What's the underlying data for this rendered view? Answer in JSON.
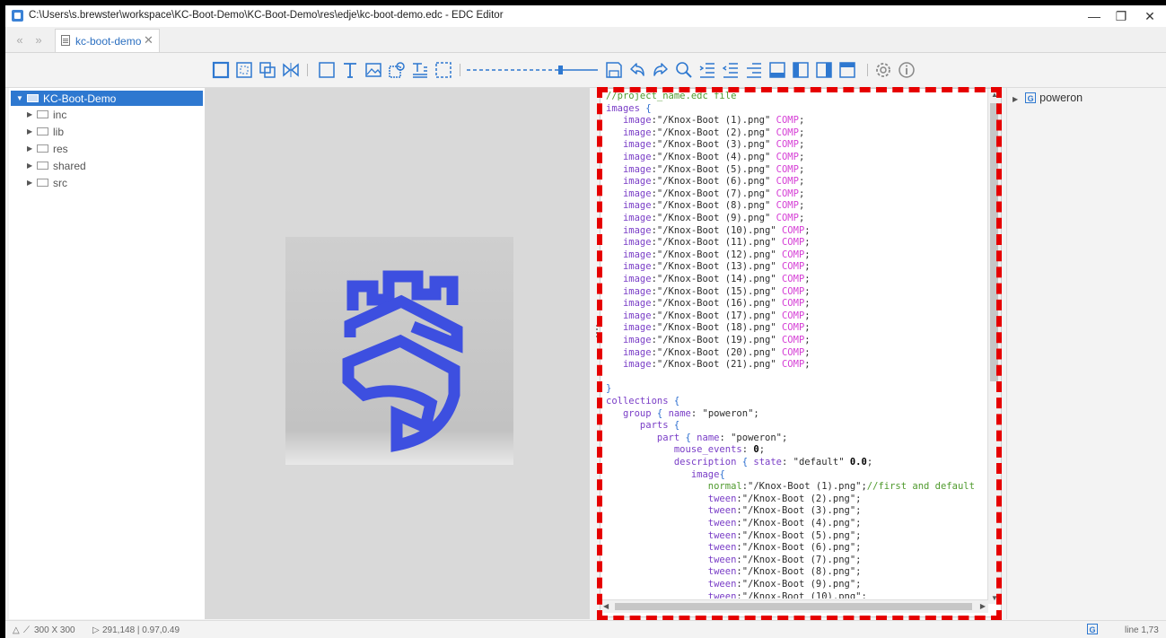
{
  "window": {
    "title": "C:\\Users\\s.brewster\\workspace\\KC-Boot-Demo\\KC-Boot-Demo\\res\\edje\\kc-boot-demo.edc - EDC Editor",
    "controls": {
      "minimize": "—",
      "restore": "❐",
      "close": "✕"
    }
  },
  "tabs": {
    "back": "«",
    "forward": "»",
    "active": {
      "label": "kc-boot-demo",
      "close": "✕"
    }
  },
  "toolbar": {
    "icons": [
      "rect-tool-icon",
      "select-tool-icon",
      "group-tool-icon",
      "mirror-tool-icon",
      "rectangle-icon",
      "text-tool-icon",
      "image-tool-icon",
      "image-settings-icon",
      "textblock-icon",
      "spacer-icon",
      "zoom-slider",
      "save-icon",
      "undo-icon",
      "redo-icon",
      "find-icon",
      "indent-icon",
      "outdent-icon",
      "format-icon",
      "bottom-panel-icon",
      "left-panel-icon",
      "right-panel-icon",
      "top-panel-icon",
      "settings-gear-icon",
      "info-icon"
    ]
  },
  "explorer": {
    "root": "KC-Boot-Demo",
    "folders": [
      "inc",
      "lib",
      "res",
      "shared",
      "src"
    ]
  },
  "editor": {
    "lines": [
      [
        {
          "t": "//project_name.edc file",
          "c": "cm"
        }
      ],
      [
        {
          "t": "images ",
          "c": "kw"
        },
        {
          "t": "{",
          "c": "br"
        }
      ],
      [
        {
          "t": "   image",
          "c": "kw"
        },
        {
          "t": ":\"/Knox-Boot (1).png\" ",
          "c": "str"
        },
        {
          "t": "COMP",
          "c": "cons"
        },
        {
          "t": ";",
          "c": "str"
        }
      ],
      [
        {
          "t": "   image",
          "c": "kw"
        },
        {
          "t": ":\"/Knox-Boot (2).png\" ",
          "c": "str"
        },
        {
          "t": "COMP",
          "c": "cons"
        },
        {
          "t": ";",
          "c": "str"
        }
      ],
      [
        {
          "t": "   image",
          "c": "kw"
        },
        {
          "t": ":\"/Knox-Boot (3).png\" ",
          "c": "str"
        },
        {
          "t": "COMP",
          "c": "cons"
        },
        {
          "t": ";",
          "c": "str"
        }
      ],
      [
        {
          "t": "   image",
          "c": "kw"
        },
        {
          "t": ":\"/Knox-Boot (4).png\" ",
          "c": "str"
        },
        {
          "t": "COMP",
          "c": "cons"
        },
        {
          "t": ";",
          "c": "str"
        }
      ],
      [
        {
          "t": "   image",
          "c": "kw"
        },
        {
          "t": ":\"/Knox-Boot (5).png\" ",
          "c": "str"
        },
        {
          "t": "COMP",
          "c": "cons"
        },
        {
          "t": ";",
          "c": "str"
        }
      ],
      [
        {
          "t": "   image",
          "c": "kw"
        },
        {
          "t": ":\"/Knox-Boot (6).png\" ",
          "c": "str"
        },
        {
          "t": "COMP",
          "c": "cons"
        },
        {
          "t": ";",
          "c": "str"
        }
      ],
      [
        {
          "t": "   image",
          "c": "kw"
        },
        {
          "t": ":\"/Knox-Boot (7).png\" ",
          "c": "str"
        },
        {
          "t": "COMP",
          "c": "cons"
        },
        {
          "t": ";",
          "c": "str"
        }
      ],
      [
        {
          "t": "   image",
          "c": "kw"
        },
        {
          "t": ":\"/Knox-Boot (8).png\" ",
          "c": "str"
        },
        {
          "t": "COMP",
          "c": "cons"
        },
        {
          "t": ";",
          "c": "str"
        }
      ],
      [
        {
          "t": "   image",
          "c": "kw"
        },
        {
          "t": ":\"/Knox-Boot (9).png\" ",
          "c": "str"
        },
        {
          "t": "COMP",
          "c": "cons"
        },
        {
          "t": ";",
          "c": "str"
        }
      ],
      [
        {
          "t": "   image",
          "c": "kw"
        },
        {
          "t": ":\"/Knox-Boot (10).png\" ",
          "c": "str"
        },
        {
          "t": "COMP",
          "c": "cons"
        },
        {
          "t": ";",
          "c": "str"
        }
      ],
      [
        {
          "t": "   image",
          "c": "kw"
        },
        {
          "t": ":\"/Knox-Boot (11).png\" ",
          "c": "str"
        },
        {
          "t": "COMP",
          "c": "cons"
        },
        {
          "t": ";",
          "c": "str"
        }
      ],
      [
        {
          "t": "   image",
          "c": "kw"
        },
        {
          "t": ":\"/Knox-Boot (12).png\" ",
          "c": "str"
        },
        {
          "t": "COMP",
          "c": "cons"
        },
        {
          "t": ";",
          "c": "str"
        }
      ],
      [
        {
          "t": "   image",
          "c": "kw"
        },
        {
          "t": ":\"/Knox-Boot (13).png\" ",
          "c": "str"
        },
        {
          "t": "COMP",
          "c": "cons"
        },
        {
          "t": ";",
          "c": "str"
        }
      ],
      [
        {
          "t": "   image",
          "c": "kw"
        },
        {
          "t": ":\"/Knox-Boot (14).png\" ",
          "c": "str"
        },
        {
          "t": "COMP",
          "c": "cons"
        },
        {
          "t": ";",
          "c": "str"
        }
      ],
      [
        {
          "t": "   image",
          "c": "kw"
        },
        {
          "t": ":\"/Knox-Boot (15).png\" ",
          "c": "str"
        },
        {
          "t": "COMP",
          "c": "cons"
        },
        {
          "t": ";",
          "c": "str"
        }
      ],
      [
        {
          "t": "   image",
          "c": "kw"
        },
        {
          "t": ":\"/Knox-Boot (16).png\" ",
          "c": "str"
        },
        {
          "t": "COMP",
          "c": "cons"
        },
        {
          "t": ";",
          "c": "str"
        }
      ],
      [
        {
          "t": "   image",
          "c": "kw"
        },
        {
          "t": ":\"/Knox-Boot (17).png\" ",
          "c": "str"
        },
        {
          "t": "COMP",
          "c": "cons"
        },
        {
          "t": ";",
          "c": "str"
        }
      ],
      [
        {
          "t": "   image",
          "c": "kw"
        },
        {
          "t": ":\"/Knox-Boot (18).png\" ",
          "c": "str"
        },
        {
          "t": "COMP",
          "c": "cons"
        },
        {
          "t": ";",
          "c": "str"
        }
      ],
      [
        {
          "t": "   image",
          "c": "kw"
        },
        {
          "t": ":\"/Knox-Boot (19).png\" ",
          "c": "str"
        },
        {
          "t": "COMP",
          "c": "cons"
        },
        {
          "t": ";",
          "c": "str"
        }
      ],
      [
        {
          "t": "   image",
          "c": "kw"
        },
        {
          "t": ":\"/Knox-Boot (20).png\" ",
          "c": "str"
        },
        {
          "t": "COMP",
          "c": "cons"
        },
        {
          "t": ";",
          "c": "str"
        }
      ],
      [
        {
          "t": "   image",
          "c": "kw"
        },
        {
          "t": ":\"/Knox-Boot (21).png\" ",
          "c": "str"
        },
        {
          "t": "COMP",
          "c": "cons"
        },
        {
          "t": ";",
          "c": "str"
        }
      ],
      [
        {
          "t": "",
          "c": "str"
        }
      ],
      [
        {
          "t": "}",
          "c": "br"
        }
      ],
      [
        {
          "t": "collections ",
          "c": "kw"
        },
        {
          "t": "{",
          "c": "br"
        }
      ],
      [
        {
          "t": "   group ",
          "c": "kw"
        },
        {
          "t": "{ ",
          "c": "br"
        },
        {
          "t": "name",
          "c": "kw"
        },
        {
          "t": ": \"poweron\";",
          "c": "str"
        }
      ],
      [
        {
          "t": "      parts ",
          "c": "kw"
        },
        {
          "t": "{",
          "c": "br"
        }
      ],
      [
        {
          "t": "         part ",
          "c": "kw"
        },
        {
          "t": "{ ",
          "c": "br"
        },
        {
          "t": "name",
          "c": "kw"
        },
        {
          "t": ": \"poweron\";",
          "c": "str"
        }
      ],
      [
        {
          "t": "            mouse_events",
          "c": "kw"
        },
        {
          "t": ": ",
          "c": "str"
        },
        {
          "t": "0",
          "c": "num"
        },
        {
          "t": ";",
          "c": "str"
        }
      ],
      [
        {
          "t": "            description ",
          "c": "kw"
        },
        {
          "t": "{ ",
          "c": "br"
        },
        {
          "t": "state",
          "c": "kw"
        },
        {
          "t": ": \"default\" ",
          "c": "str"
        },
        {
          "t": "0.0",
          "c": "num"
        },
        {
          "t": ";",
          "c": "str"
        }
      ],
      [
        {
          "t": "               image",
          "c": "kw"
        },
        {
          "t": "{",
          "c": "br"
        }
      ],
      [
        {
          "t": "                  normal",
          "c": "cm"
        },
        {
          "t": ":\"/Knox-Boot (1).png\";",
          "c": "str"
        },
        {
          "t": "//first and default",
          "c": "cm"
        }
      ],
      [
        {
          "t": "                  tween",
          "c": "kw"
        },
        {
          "t": ":\"/Knox-Boot (2).png\";",
          "c": "str"
        }
      ],
      [
        {
          "t": "                  tween",
          "c": "kw"
        },
        {
          "t": ":\"/Knox-Boot (3).png\";",
          "c": "str"
        }
      ],
      [
        {
          "t": "                  tween",
          "c": "kw"
        },
        {
          "t": ":\"/Knox-Boot (4).png\";",
          "c": "str"
        }
      ],
      [
        {
          "t": "                  tween",
          "c": "kw"
        },
        {
          "t": ":\"/Knox-Boot (5).png\";",
          "c": "str"
        }
      ],
      [
        {
          "t": "                  tween",
          "c": "kw"
        },
        {
          "t": ":\"/Knox-Boot (6).png\";",
          "c": "str"
        }
      ],
      [
        {
          "t": "                  tween",
          "c": "kw"
        },
        {
          "t": ":\"/Knox-Boot (7).png\";",
          "c": "str"
        }
      ],
      [
        {
          "t": "                  tween",
          "c": "kw"
        },
        {
          "t": ":\"/Knox-Boot (8).png\";",
          "c": "str"
        }
      ],
      [
        {
          "t": "                  tween",
          "c": "kw"
        },
        {
          "t": ":\"/Knox-Boot (9).png\";",
          "c": "str"
        }
      ],
      [
        {
          "t": "                  tween",
          "c": "kw"
        },
        {
          "t": ":\"/Knox-Boot (10).png\";",
          "c": "str"
        }
      ]
    ]
  },
  "outline": {
    "item": "poweron",
    "icon_letter": "G"
  },
  "status": {
    "size": "300 X 300",
    "coords": "291,148 | 0.97,0.49",
    "line": "line 1,73"
  },
  "colors": {
    "accent": "#2e78d0",
    "highlight": "#e60000",
    "logo": "#3d4fe0"
  }
}
